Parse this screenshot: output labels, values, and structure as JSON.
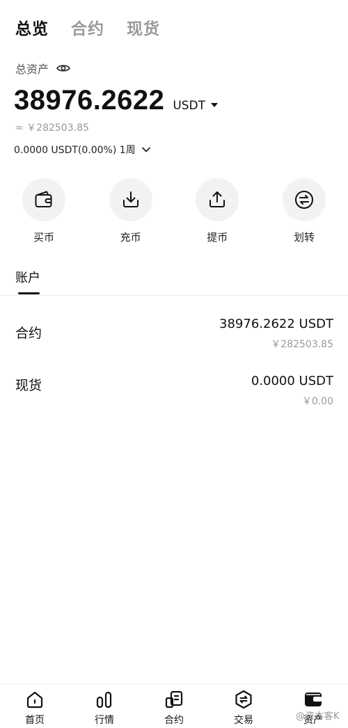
{
  "top_tabs": [
    {
      "label": "总览",
      "active": true
    },
    {
      "label": "合约",
      "active": false
    },
    {
      "label": "现货",
      "active": false
    }
  ],
  "summary": {
    "asset_label": "总资产",
    "balance": "38976.2622",
    "currency": "USDT",
    "approx_fiat": "≈ ￥282503.85",
    "pnl_text": "0.0000 USDT(0.00%) 1周"
  },
  "actions": [
    {
      "label": "买币",
      "icon": "wallet-icon"
    },
    {
      "label": "充币",
      "icon": "deposit-icon"
    },
    {
      "label": "提币",
      "icon": "withdraw-icon"
    },
    {
      "label": "划转",
      "icon": "transfer-icon"
    }
  ],
  "accounts_section": {
    "title": "账户",
    "items": [
      {
        "name": "合约",
        "value": "38976.2622 USDT",
        "fiat": "￥282503.85"
      },
      {
        "name": "现货",
        "value": "0.0000 USDT",
        "fiat": "￥0.00"
      }
    ]
  },
  "bottom_nav": [
    {
      "label": "首页",
      "icon": "home-icon"
    },
    {
      "label": "行情",
      "icon": "market-icon"
    },
    {
      "label": "合约",
      "icon": "contract-icon"
    },
    {
      "label": "交易",
      "icon": "trade-icon"
    },
    {
      "label": "资产",
      "icon": "assets-icon",
      "active": true
    }
  ],
  "watermark": "@资本客K"
}
